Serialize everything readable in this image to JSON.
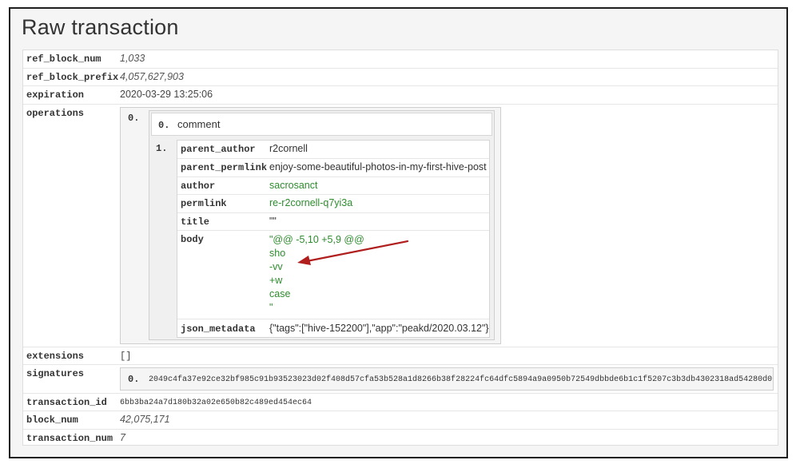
{
  "page": {
    "title": "Raw transaction"
  },
  "fields": {
    "ref_block_num": {
      "key": "ref_block_num",
      "value": "1,033"
    },
    "ref_block_prefix": {
      "key": "ref_block_prefix",
      "value": "4,057,627,903"
    },
    "expiration": {
      "key": "expiration",
      "value": "2020-03-29 13:25:06"
    },
    "operations": {
      "key": "operations"
    },
    "extensions": {
      "key": "extensions",
      "value": "[]"
    },
    "signatures": {
      "key": "signatures"
    },
    "transaction_id": {
      "key": "transaction_id",
      "value": "6bb3ba24a7d180b32a02e650b82c489ed454ec64"
    },
    "block_num": {
      "key": "block_num",
      "value": "42,075,171"
    },
    "transaction_num": {
      "key": "transaction_num",
      "value": "7"
    }
  },
  "operation": {
    "outer_index": "0.",
    "type_index": "0.",
    "type": "comment",
    "payload_index": "1.",
    "payload": {
      "parent_author": {
        "key": "parent_author",
        "value": "r2cornell"
      },
      "parent_permlink": {
        "key": "parent_permlink",
        "value": "enjoy-some-beautiful-photos-in-my-first-hive-post"
      },
      "author": {
        "key": "author",
        "value": "sacrosanct"
      },
      "permlink": {
        "key": "permlink",
        "value": "re-r2cornell-q7yi3a"
      },
      "title": {
        "key": "title",
        "value": "\"\""
      },
      "body": {
        "key": "body",
        "lines": [
          "\"@@ -5,10 +5,9 @@",
          "sho",
          "-vv",
          "+w",
          "case",
          "\""
        ]
      },
      "json_metadata": {
        "key": "json_metadata",
        "value": "{\"tags\":[\"hive-152200\"],\"app\":\"peakd/2020.03.12\"}"
      }
    }
  },
  "signature": {
    "index": "0.",
    "value": "2049c4fa37e92ce32bf985c91b93523023d02f408d57cfa53b528a1d8266b38f28224fc64dfc5894a9a0950b72549dbbde6b1c1f5207c3b3db4302318ad54280d0"
  },
  "colors": {
    "green": "#2e8b2e",
    "arrow": "#b01e1e"
  }
}
